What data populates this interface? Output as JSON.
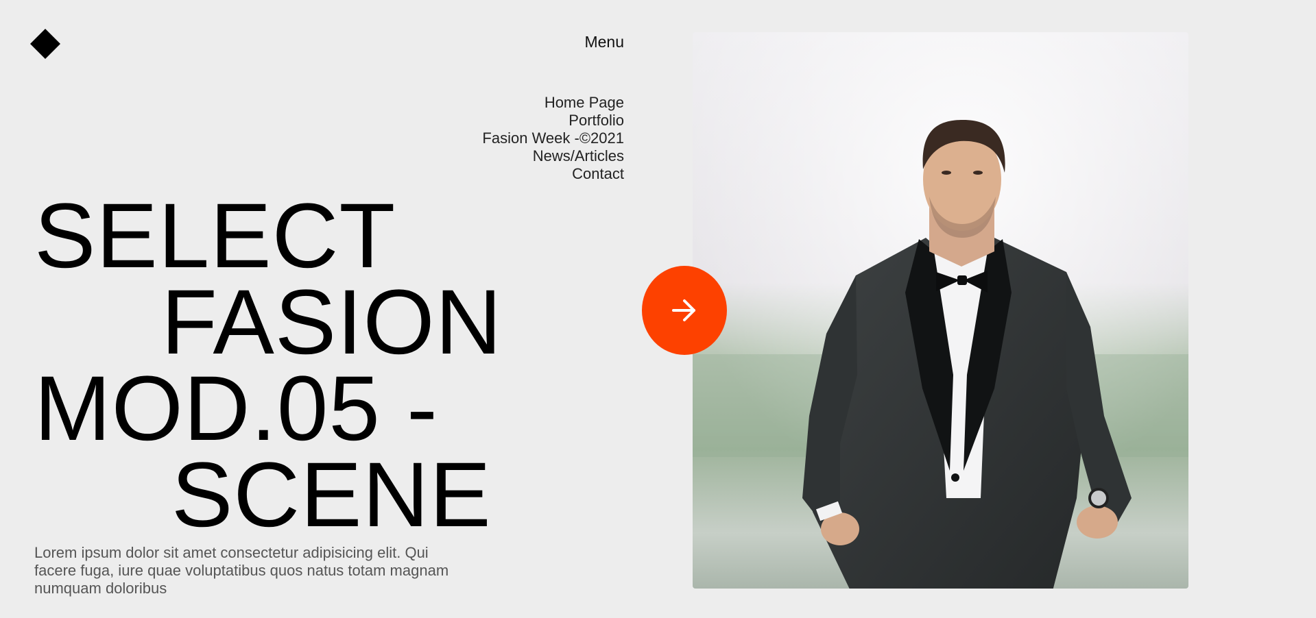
{
  "header": {
    "menu_label": "Menu"
  },
  "nav": {
    "items": [
      {
        "label": "Home Page"
      },
      {
        "label": "Portfolio"
      },
      {
        "label": "Fasion Week -©2021"
      },
      {
        "label": "News/Articles"
      },
      {
        "label": "Contact"
      }
    ]
  },
  "hero": {
    "headline_lines": [
      "SELECT",
      "FASION",
      "MOD.05 -",
      "SCENE"
    ],
    "description": "Lorem ipsum dolor sit amet consectetur adipisicing elit. Qui facere fuga, iure quae voluptatibus quos natus totam magnam numquam doloribus"
  },
  "icons": {
    "logo": "diamond-logo-icon",
    "next": "arrow-right-icon"
  },
  "colors": {
    "background": "#ededed",
    "accent": "#fd4100",
    "text": "#000000",
    "muted_text": "#555555"
  }
}
